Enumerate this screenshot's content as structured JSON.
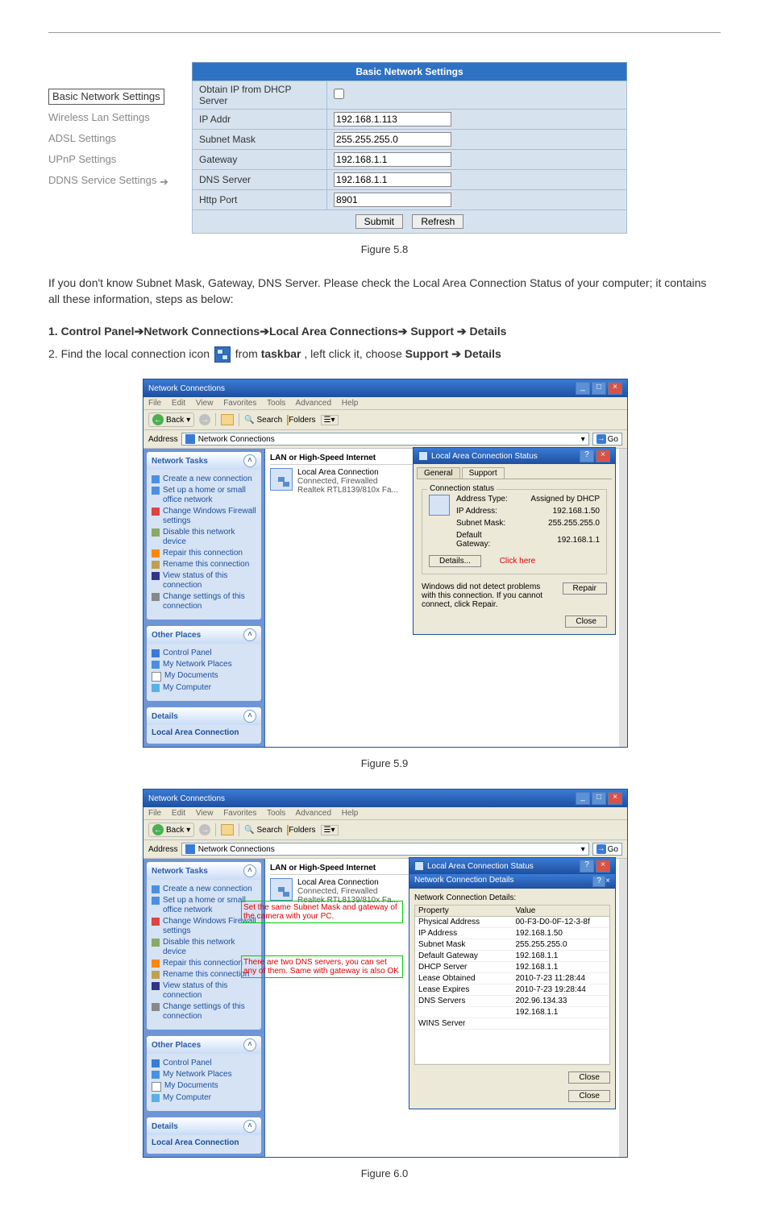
{
  "sidebar": {
    "items": [
      {
        "label": "Basic Network Settings",
        "selected": true
      },
      {
        "label": "Wireless Lan Settings"
      },
      {
        "label": "ADSL Settings"
      },
      {
        "label": "UPnP Settings"
      },
      {
        "label": "DDNS Service Settings",
        "arrow": true
      }
    ]
  },
  "settings": {
    "title": "Basic Network Settings",
    "rows": [
      {
        "label": "Obtain IP from DHCP Server",
        "type": "checkbox",
        "value": ""
      },
      {
        "label": "IP Addr",
        "type": "text",
        "value": "192.168.1.113"
      },
      {
        "label": "Subnet Mask",
        "type": "text",
        "value": "255.255.255.0"
      },
      {
        "label": "Gateway",
        "type": "text",
        "value": "192.168.1.1"
      },
      {
        "label": "DNS Server",
        "type": "text",
        "value": "192.168.1.1"
      },
      {
        "label": "Http Port",
        "type": "text",
        "value": "8901"
      }
    ],
    "submit": "Submit",
    "refresh": "Refresh"
  },
  "captions": {
    "f58": "Figure 5.8",
    "f59": "Figure 5.9",
    "f60": "Figure 6.0"
  },
  "text": {
    "intro": "If you don't know Subnet Mask, Gateway, DNS Server. Please check the Local Area Connection Status of your computer; it contains all these information, steps as below:",
    "step1_pre": "1. Control Panel",
    "step1_parts": [
      "Network Connections",
      "Local Area Connections",
      " Support ",
      " Details"
    ],
    "step2_a": "2. Find the local connection icon ",
    "step2_b": " from ",
    "step2_tb": "taskbar",
    "step2_c": ", left click it, choose ",
    "step2_s": "Support ",
    "step2_arrow": "➔",
    "step2_d": " Details"
  },
  "win": {
    "title": "Network Connections",
    "menus": [
      "File",
      "Edit",
      "View",
      "Favorites",
      "Tools",
      "Advanced",
      "Help"
    ],
    "back": "Back",
    "search": "Search",
    "folders": "Folders",
    "addrLabel": "Address",
    "addrValue": "Network Connections",
    "go": "Go",
    "tasksHdr": "Network Tasks",
    "tasks": [
      "Create a new connection",
      "Set up a home or small office network",
      "Change Windows Firewall settings",
      "Disable this network device",
      "Repair this connection",
      "Rename this connection",
      "View status of this connection",
      "Change settings of this connection"
    ],
    "otherHdr": "Other Places",
    "other": [
      "Control Panel",
      "My Network Places",
      "My Documents",
      "My Computer"
    ],
    "detailsHdr": "Details",
    "lacHdr": "Local Area Connection",
    "lanGroup": "LAN or High-Speed Internet",
    "connItem": {
      "title": "Local Area Connection",
      "status": "Connected, Firewalled",
      "nic": "Realtek RTL8139/810x Fa..."
    }
  },
  "dlgStatus": {
    "title": "Local Area Connection Status",
    "tabGeneral": "General",
    "tabSupport": "Support",
    "group": "Connection status",
    "rows": [
      [
        "Address Type:",
        "Assigned by DHCP"
      ],
      [
        "IP Address:",
        "192.168.1.50"
      ],
      [
        "Subnet Mask:",
        "255.255.255.0"
      ],
      [
        "Default Gateway:",
        "192.168.1.1"
      ]
    ],
    "detailsBtn": "Details...",
    "clickHere": "Click here",
    "msg": "Windows did not detect problems with this connection. If you cannot connect, click Repair.",
    "repair": "Repair",
    "close": "Close"
  },
  "dlgDetails": {
    "title": "Local Area Connection Status",
    "subTitle": "Network Connection Details",
    "label": "Network Connection Details:",
    "hdrs": [
      "Property",
      "Value"
    ],
    "rows": [
      [
        "Physical Address",
        "00-F3-D0-0F-12-3-8f"
      ],
      [
        "IP Address",
        "192.168.1.50"
      ],
      [
        "Subnet Mask",
        "255.255.255.0"
      ],
      [
        "Default Gateway",
        "192.168.1.1"
      ],
      [
        "DHCP Server",
        "192.168.1.1"
      ],
      [
        "Lease Obtained",
        "2010-7-23 11:28:44"
      ],
      [
        "Lease Expires",
        "2010-7-23 19:28:44"
      ],
      [
        "DNS Servers",
        "202.96.134.33"
      ],
      [
        "",
        "192.168.1.1"
      ],
      [
        "WINS Server",
        ""
      ]
    ],
    "close": "Close"
  },
  "ann": {
    "note1": "Set the same Subnet Mask and gateway of the camera with your PC.",
    "note2": "There are two DNS servers, you can set any of them. Same with gateway is also OK"
  }
}
